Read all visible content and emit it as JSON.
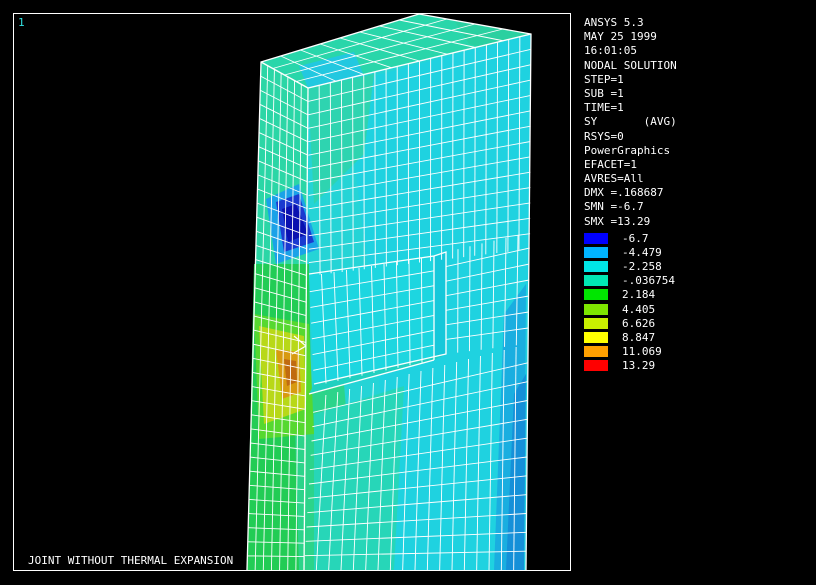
{
  "viewport": {
    "window_number": "1",
    "caption": "JOINT WITHOUT THERMAL EXPANSION"
  },
  "info_lines": [
    "ANSYS 5.3",
    "MAY 25 1999",
    "16:01:05",
    "NODAL SOLUTION",
    "STEP=1",
    "SUB =1",
    "TIME=1",
    "SY       (AVG)",
    "RSYS=0",
    "PowerGraphics",
    "EFACET=1",
    "AVRES=All",
    "DMX =.168687",
    "SMN =-6.7",
    "SMX =13.29"
  ],
  "legend": [
    {
      "label": "-6.7",
      "color": "#0000ff"
    },
    {
      "label": "-4.479",
      "color": "#00b4ff"
    },
    {
      "label": "-2.258",
      "color": "#00e6e6"
    },
    {
      "label": "-.036754",
      "color": "#00e8b4"
    },
    {
      "label": "2.184",
      "color": "#00e600"
    },
    {
      "label": "4.405",
      "color": "#7ee600"
    },
    {
      "label": "6.626",
      "color": "#c8f000"
    },
    {
      "label": "8.847",
      "color": "#ffff00"
    },
    {
      "label": "11.069",
      "color": "#ffa000"
    },
    {
      "label": "13.29",
      "color": "#ff0000"
    }
  ]
}
